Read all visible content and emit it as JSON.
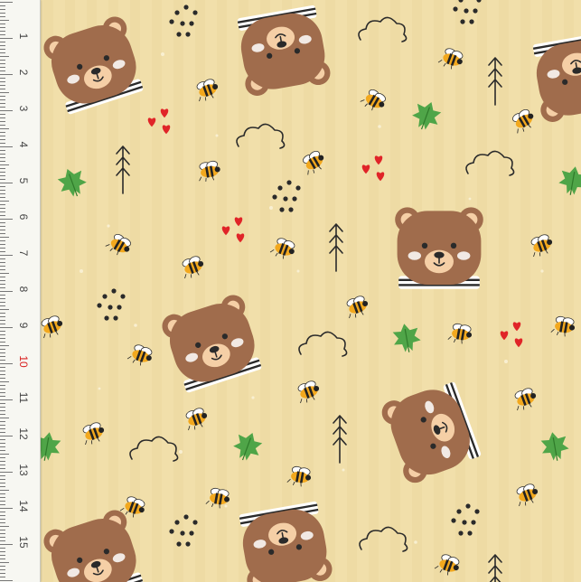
{
  "ruler": {
    "unit": "cm",
    "labels": [
      "1",
      "2",
      "3",
      "4",
      "5",
      "6",
      "7",
      "8",
      "9",
      "10",
      "11",
      "12",
      "13",
      "14",
      "15"
    ],
    "highlight_label": "10",
    "highlight_color": "#d82020"
  },
  "fabric": {
    "background_color": "#f1dfaa",
    "bear_color": "#a06c4c",
    "muzzle_color": "#f5cfa6",
    "heart_color": "#e02428",
    "leaf_color": "#4fa548",
    "bee_color": "#f2a81e",
    "motifs": [
      "bear-head",
      "bee",
      "heart",
      "leaf",
      "cloud",
      "arrow-tree",
      "dot-cluster"
    ]
  }
}
